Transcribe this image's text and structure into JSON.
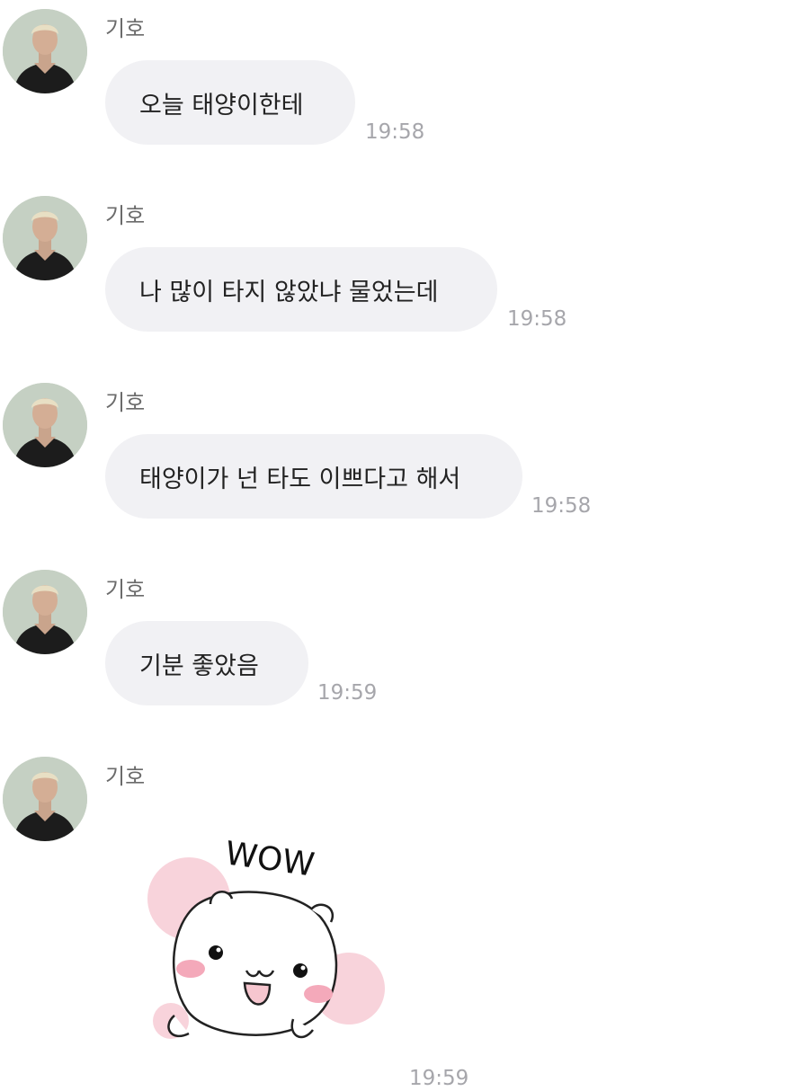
{
  "messages": [
    {
      "sender": "기호",
      "text": "오늘 태양이한테",
      "time": "19:58"
    },
    {
      "sender": "기호",
      "text": "나 많이 타지 않았냐 물었는데",
      "time": "19:58"
    },
    {
      "sender": "기호",
      "text": "태양이가 넌 타도 이쁘다고 해서",
      "time": "19:58"
    },
    {
      "sender": "기호",
      "text": "기분 좋았음",
      "time": "19:59"
    }
  ],
  "sticker_message": {
    "sender": "기호",
    "sticker_text": "WOW",
    "time": "19:59"
  },
  "colors": {
    "background": "#ffffff",
    "bubble": "#f1f1f4",
    "time_text": "#a6a6ab",
    "blush": "#f7c9d3"
  },
  "icons": {
    "avatar": "profile-photo",
    "sticker": "wow-bear-sticker"
  }
}
